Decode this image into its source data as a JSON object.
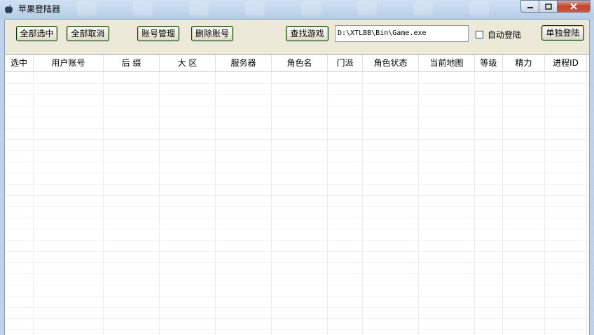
{
  "window": {
    "title": "苹果登陆器"
  },
  "toolbar": {
    "select_all": "全部选中",
    "cancel_all": "全部取消",
    "account_manage": "账号管理",
    "delete_account": "删除账号",
    "find_game": "查找游戏",
    "game_path": "D:\\XTLBB\\Bin\\Game.exe",
    "auto_login": "自动登陆",
    "auto_login_checked": false,
    "single_login": "单独登陆"
  },
  "table": {
    "columns": [
      "选中",
      "用户账号",
      "后 缀",
      "大 区",
      "服务器",
      "角色名",
      "门派",
      "角色状态",
      "当前地图",
      "等级",
      "精力",
      "进程ID"
    ],
    "rows": []
  },
  "icons": {
    "app": "apple-icon",
    "minimize": "minimize-icon",
    "maximize": "maximize-icon",
    "close": "close-icon"
  },
  "colors": {
    "client_bg": "#ece9d8",
    "button_border": "#003c00",
    "close_button": "#c7422d"
  }
}
